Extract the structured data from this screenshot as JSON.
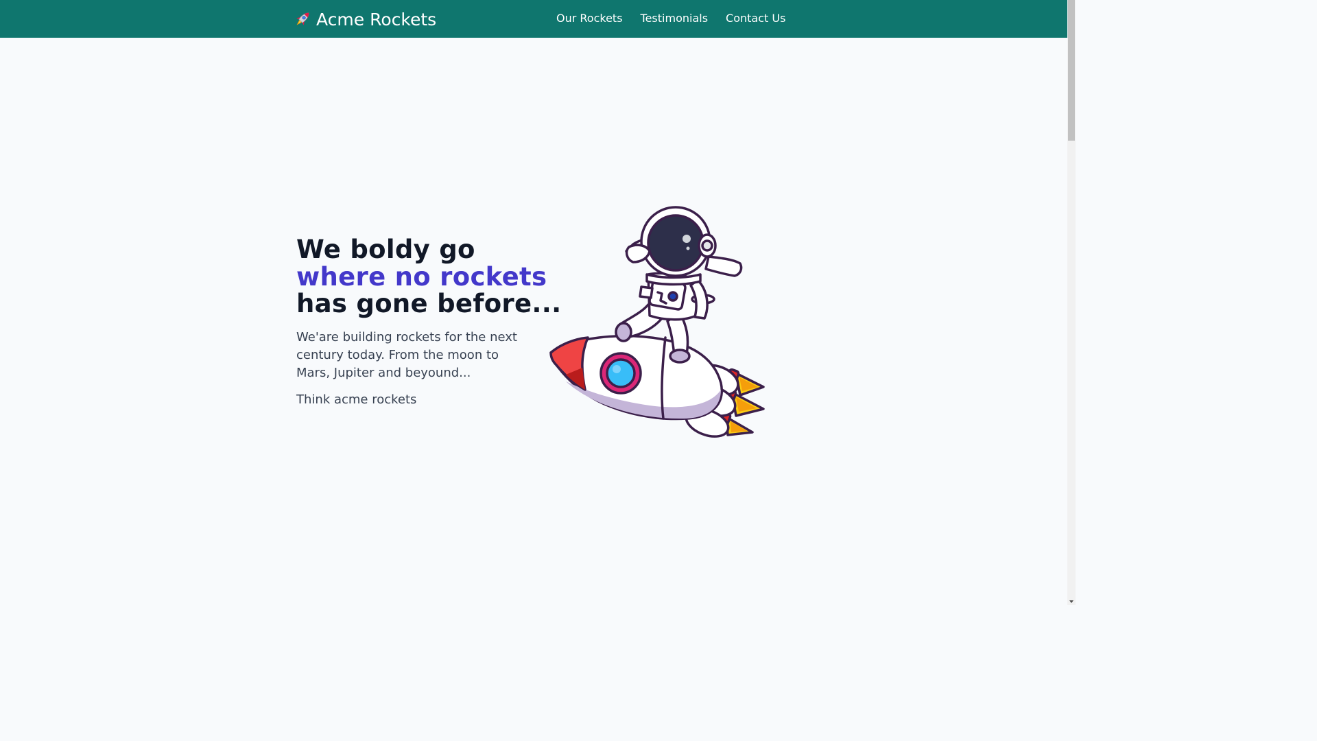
{
  "header": {
    "brand_icon": "rocket-icon",
    "brand_name": "Acme Rockets",
    "nav": [
      {
        "label": "Our Rockets"
      },
      {
        "label": "Testimonials"
      },
      {
        "label": "Contact Us"
      }
    ],
    "background": "#0f766e"
  },
  "hero": {
    "headline_line1": "We boldy go",
    "headline_line2": "where no rockets",
    "headline_line3": "has gone before...",
    "accent_color": "#4338ca",
    "lead": "We'are building rockets for the next century today. From the moon to Mars, Jupiter and beyound...",
    "tagline": "Think acme rockets",
    "illustration": "astronaut-riding-rocket-illustration"
  }
}
